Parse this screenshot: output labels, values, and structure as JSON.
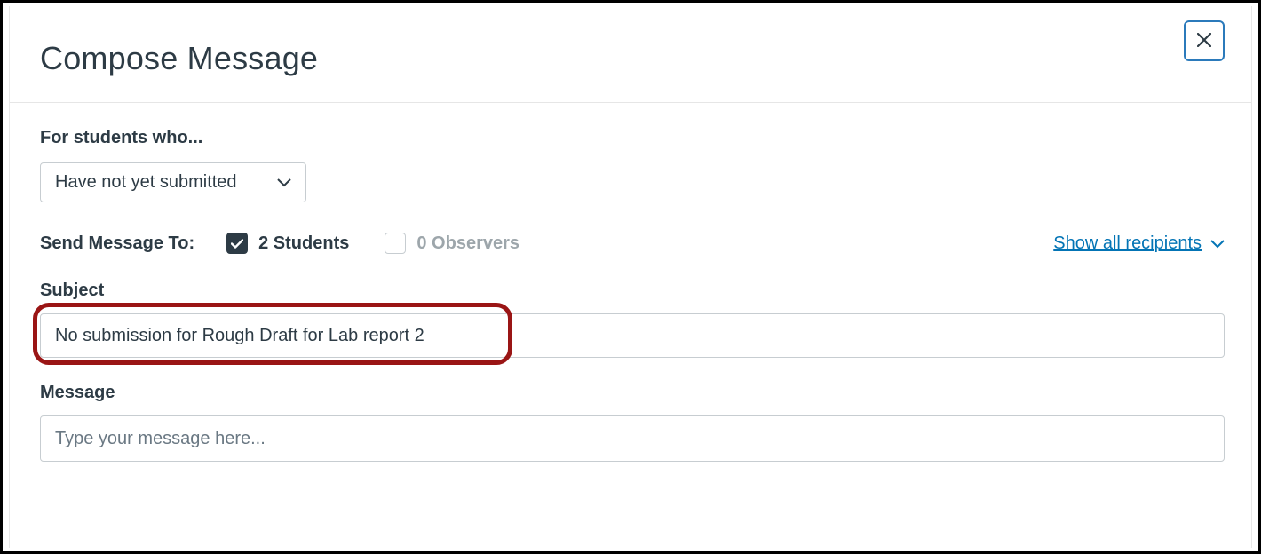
{
  "header": {
    "title": "Compose Message"
  },
  "filter": {
    "label": "For students who...",
    "selected": "Have not yet submitted"
  },
  "sendTo": {
    "label": "Send Message To:",
    "students": {
      "checked": true,
      "label": "2 Students"
    },
    "observers": {
      "checked": false,
      "label": "0 Observers"
    },
    "showAll": "Show all recipients"
  },
  "subject": {
    "label": "Subject",
    "value": "No submission for Rough Draft for Lab report 2"
  },
  "message": {
    "label": "Message",
    "placeholder": "Type your message here..."
  }
}
